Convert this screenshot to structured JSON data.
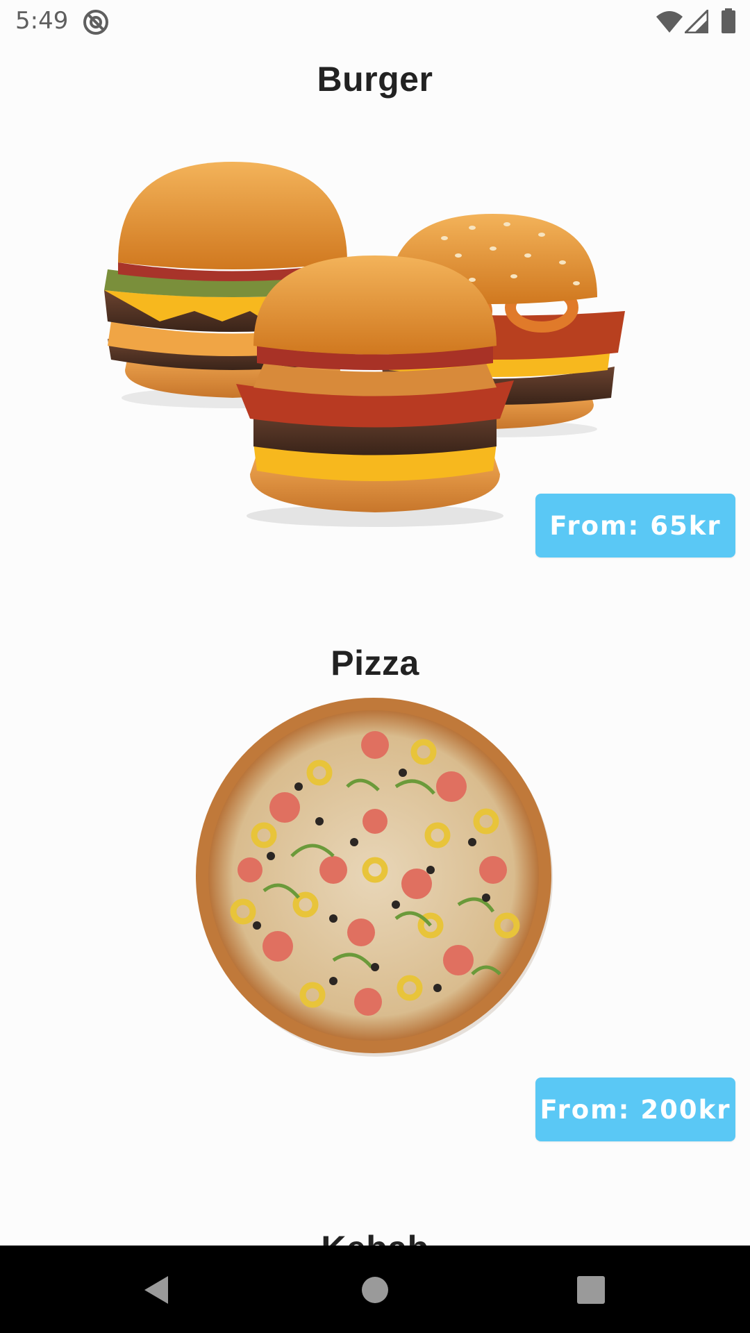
{
  "status_bar": {
    "time": "5:49",
    "icons": [
      "notification-blocked-icon",
      "wifi-icon",
      "cell-signal-icon",
      "battery-icon"
    ]
  },
  "theme": {
    "price_button_color": "#5ac8f5",
    "title_color": "#222222",
    "background": "#fcfcfc"
  },
  "foods": [
    {
      "name": "Burger",
      "price_label": "From: 65kr",
      "image": "burger-image"
    },
    {
      "name": "Pizza",
      "price_label": "From: 200kr",
      "image": "pizza-image"
    },
    {
      "name": "Kebab"
    }
  ],
  "nav_bar": {
    "buttons": [
      "back-icon",
      "home-icon",
      "recents-icon"
    ]
  }
}
